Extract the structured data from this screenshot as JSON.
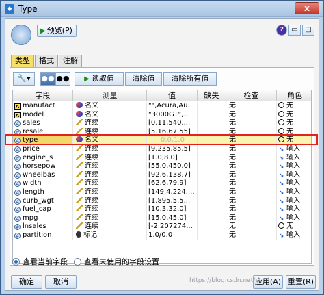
{
  "window": {
    "title": "Type",
    "close_glyph": "x"
  },
  "toolbar": {
    "preview_label": "预览(P)"
  },
  "tabs": [
    "类型",
    "格式",
    "注解"
  ],
  "actions": {
    "read_values": "读取值",
    "clear_values": "清除值",
    "clear_all_values": "清除所有值"
  },
  "grid": {
    "headers": [
      "字段",
      "测量",
      "值",
      "缺失",
      "检查",
      "角色"
    ],
    "rows": [
      {
        "field": "manufact",
        "field_type": "string",
        "measure": "名义",
        "measure_type": "nominal",
        "value": "\"\",Acura,Au...",
        "missing": "",
        "check": "无",
        "role": "无",
        "role_type": "none"
      },
      {
        "field": "model",
        "field_type": "string",
        "measure": "名义",
        "measure_type": "nominal",
        "value": "\"3000GT\",...",
        "missing": "",
        "check": "无",
        "role": "无",
        "role_type": "none"
      },
      {
        "field": "sales",
        "field_type": "number",
        "measure": "连续",
        "measure_type": "continuous",
        "value": "[0.11,540....",
        "missing": "",
        "check": "无",
        "role": "无",
        "role_type": "none"
      },
      {
        "field": "resale",
        "field_type": "number",
        "measure": "连续",
        "measure_type": "continuous",
        "value": "[5.16,67.55]",
        "missing": "",
        "check": "无",
        "role": "无",
        "role_type": "none"
      },
      {
        "field": "type",
        "field_type": "number",
        "measure": "名义",
        "measure_type": "nominal",
        "value": "0.0,1.0",
        "missing": "",
        "check": "无",
        "role": "无",
        "role_type": "none",
        "selected": true
      },
      {
        "field": "price",
        "field_type": "number",
        "measure": "连续",
        "measure_type": "continuous",
        "value": "[9.235,85.5]",
        "missing": "",
        "check": "无",
        "role": "输入",
        "role_type": "input"
      },
      {
        "field": "engine_s",
        "field_type": "number",
        "measure": "连续",
        "measure_type": "continuous",
        "value": "[1.0,8.0]",
        "missing": "",
        "check": "无",
        "role": "输入",
        "role_type": "input"
      },
      {
        "field": "horsepow",
        "field_type": "number",
        "measure": "连续",
        "measure_type": "continuous",
        "value": "[55.0,450.0]",
        "missing": "",
        "check": "无",
        "role": "输入",
        "role_type": "input"
      },
      {
        "field": "wheelbas",
        "field_type": "number",
        "measure": "连续",
        "measure_type": "continuous",
        "value": "[92.6,138.7]",
        "missing": "",
        "check": "无",
        "role": "输入",
        "role_type": "input"
      },
      {
        "field": "width",
        "field_type": "number",
        "measure": "连续",
        "measure_type": "continuous",
        "value": "[62.6,79.9]",
        "missing": "",
        "check": "无",
        "role": "输入",
        "role_type": "input"
      },
      {
        "field": "length",
        "field_type": "number",
        "measure": "连续",
        "measure_type": "continuous",
        "value": "[149.4,224....",
        "missing": "",
        "check": "无",
        "role": "输入",
        "role_type": "input"
      },
      {
        "field": "curb_wgt",
        "field_type": "number",
        "measure": "连续",
        "measure_type": "continuous",
        "value": "[1.895,5.5...",
        "missing": "",
        "check": "无",
        "role": "输入",
        "role_type": "input"
      },
      {
        "field": "fuel_cap",
        "field_type": "number",
        "measure": "连续",
        "measure_type": "continuous",
        "value": "[10.3,32.0]",
        "missing": "",
        "check": "无",
        "role": "输入",
        "role_type": "input"
      },
      {
        "field": "mpg",
        "field_type": "number",
        "measure": "连续",
        "measure_type": "continuous",
        "value": "[15.0,45.0]",
        "missing": "",
        "check": "无",
        "role": "输入",
        "role_type": "input"
      },
      {
        "field": "lnsales",
        "field_type": "number",
        "measure": "连续",
        "measure_type": "continuous",
        "value": "[-2.207274...",
        "missing": "",
        "check": "无",
        "role": "无",
        "role_type": "none"
      },
      {
        "field": "partition",
        "field_type": "number",
        "measure": "标记",
        "measure_type": "flag",
        "value": "1.0/0.0",
        "missing": "",
        "check": "无",
        "role": "输入",
        "role_type": "input"
      }
    ]
  },
  "view_options": {
    "current": "查看当前字段",
    "unused": "查看未使用的字段设置"
  },
  "buttons": {
    "ok": "确定",
    "cancel": "取消",
    "apply": "应用(A)",
    "reset": "重置(R)"
  },
  "watermark": "https://blog.csdn.net/qq_4..."
}
